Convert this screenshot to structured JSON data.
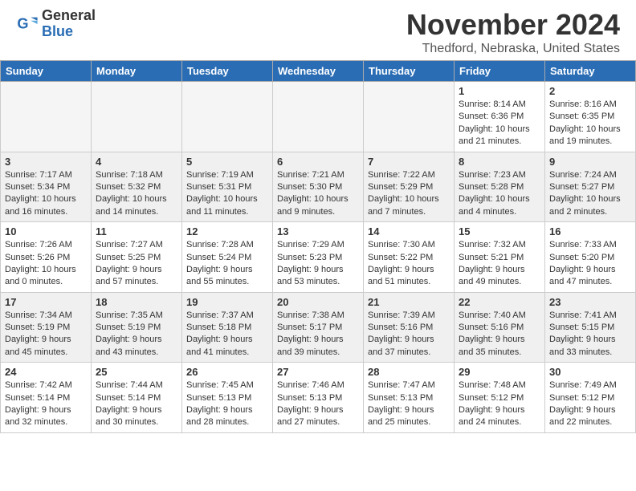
{
  "header": {
    "logo_general": "General",
    "logo_blue": "Blue",
    "month_title": "November 2024",
    "location": "Thedford, Nebraska, United States"
  },
  "weekdays": [
    "Sunday",
    "Monday",
    "Tuesday",
    "Wednesday",
    "Thursday",
    "Friday",
    "Saturday"
  ],
  "weeks": [
    [
      {
        "day": "",
        "info": ""
      },
      {
        "day": "",
        "info": ""
      },
      {
        "day": "",
        "info": ""
      },
      {
        "day": "",
        "info": ""
      },
      {
        "day": "",
        "info": ""
      },
      {
        "day": "1",
        "info": "Sunrise: 8:14 AM\nSunset: 6:36 PM\nDaylight: 10 hours and 21 minutes."
      },
      {
        "day": "2",
        "info": "Sunrise: 8:16 AM\nSunset: 6:35 PM\nDaylight: 10 hours and 19 minutes."
      }
    ],
    [
      {
        "day": "3",
        "info": "Sunrise: 7:17 AM\nSunset: 5:34 PM\nDaylight: 10 hours and 16 minutes."
      },
      {
        "day": "4",
        "info": "Sunrise: 7:18 AM\nSunset: 5:32 PM\nDaylight: 10 hours and 14 minutes."
      },
      {
        "day": "5",
        "info": "Sunrise: 7:19 AM\nSunset: 5:31 PM\nDaylight: 10 hours and 11 minutes."
      },
      {
        "day": "6",
        "info": "Sunrise: 7:21 AM\nSunset: 5:30 PM\nDaylight: 10 hours and 9 minutes."
      },
      {
        "day": "7",
        "info": "Sunrise: 7:22 AM\nSunset: 5:29 PM\nDaylight: 10 hours and 7 minutes."
      },
      {
        "day": "8",
        "info": "Sunrise: 7:23 AM\nSunset: 5:28 PM\nDaylight: 10 hours and 4 minutes."
      },
      {
        "day": "9",
        "info": "Sunrise: 7:24 AM\nSunset: 5:27 PM\nDaylight: 10 hours and 2 minutes."
      }
    ],
    [
      {
        "day": "10",
        "info": "Sunrise: 7:26 AM\nSunset: 5:26 PM\nDaylight: 10 hours and 0 minutes."
      },
      {
        "day": "11",
        "info": "Sunrise: 7:27 AM\nSunset: 5:25 PM\nDaylight: 9 hours and 57 minutes."
      },
      {
        "day": "12",
        "info": "Sunrise: 7:28 AM\nSunset: 5:24 PM\nDaylight: 9 hours and 55 minutes."
      },
      {
        "day": "13",
        "info": "Sunrise: 7:29 AM\nSunset: 5:23 PM\nDaylight: 9 hours and 53 minutes."
      },
      {
        "day": "14",
        "info": "Sunrise: 7:30 AM\nSunset: 5:22 PM\nDaylight: 9 hours and 51 minutes."
      },
      {
        "day": "15",
        "info": "Sunrise: 7:32 AM\nSunset: 5:21 PM\nDaylight: 9 hours and 49 minutes."
      },
      {
        "day": "16",
        "info": "Sunrise: 7:33 AM\nSunset: 5:20 PM\nDaylight: 9 hours and 47 minutes."
      }
    ],
    [
      {
        "day": "17",
        "info": "Sunrise: 7:34 AM\nSunset: 5:19 PM\nDaylight: 9 hours and 45 minutes."
      },
      {
        "day": "18",
        "info": "Sunrise: 7:35 AM\nSunset: 5:19 PM\nDaylight: 9 hours and 43 minutes."
      },
      {
        "day": "19",
        "info": "Sunrise: 7:37 AM\nSunset: 5:18 PM\nDaylight: 9 hours and 41 minutes."
      },
      {
        "day": "20",
        "info": "Sunrise: 7:38 AM\nSunset: 5:17 PM\nDaylight: 9 hours and 39 minutes."
      },
      {
        "day": "21",
        "info": "Sunrise: 7:39 AM\nSunset: 5:16 PM\nDaylight: 9 hours and 37 minutes."
      },
      {
        "day": "22",
        "info": "Sunrise: 7:40 AM\nSunset: 5:16 PM\nDaylight: 9 hours and 35 minutes."
      },
      {
        "day": "23",
        "info": "Sunrise: 7:41 AM\nSunset: 5:15 PM\nDaylight: 9 hours and 33 minutes."
      }
    ],
    [
      {
        "day": "24",
        "info": "Sunrise: 7:42 AM\nSunset: 5:14 PM\nDaylight: 9 hours and 32 minutes."
      },
      {
        "day": "25",
        "info": "Sunrise: 7:44 AM\nSunset: 5:14 PM\nDaylight: 9 hours and 30 minutes."
      },
      {
        "day": "26",
        "info": "Sunrise: 7:45 AM\nSunset: 5:13 PM\nDaylight: 9 hours and 28 minutes."
      },
      {
        "day": "27",
        "info": "Sunrise: 7:46 AM\nSunset: 5:13 PM\nDaylight: 9 hours and 27 minutes."
      },
      {
        "day": "28",
        "info": "Sunrise: 7:47 AM\nSunset: 5:13 PM\nDaylight: 9 hours and 25 minutes."
      },
      {
        "day": "29",
        "info": "Sunrise: 7:48 AM\nSunset: 5:12 PM\nDaylight: 9 hours and 24 minutes."
      },
      {
        "day": "30",
        "info": "Sunrise: 7:49 AM\nSunset: 5:12 PM\nDaylight: 9 hours and 22 minutes."
      }
    ]
  ]
}
